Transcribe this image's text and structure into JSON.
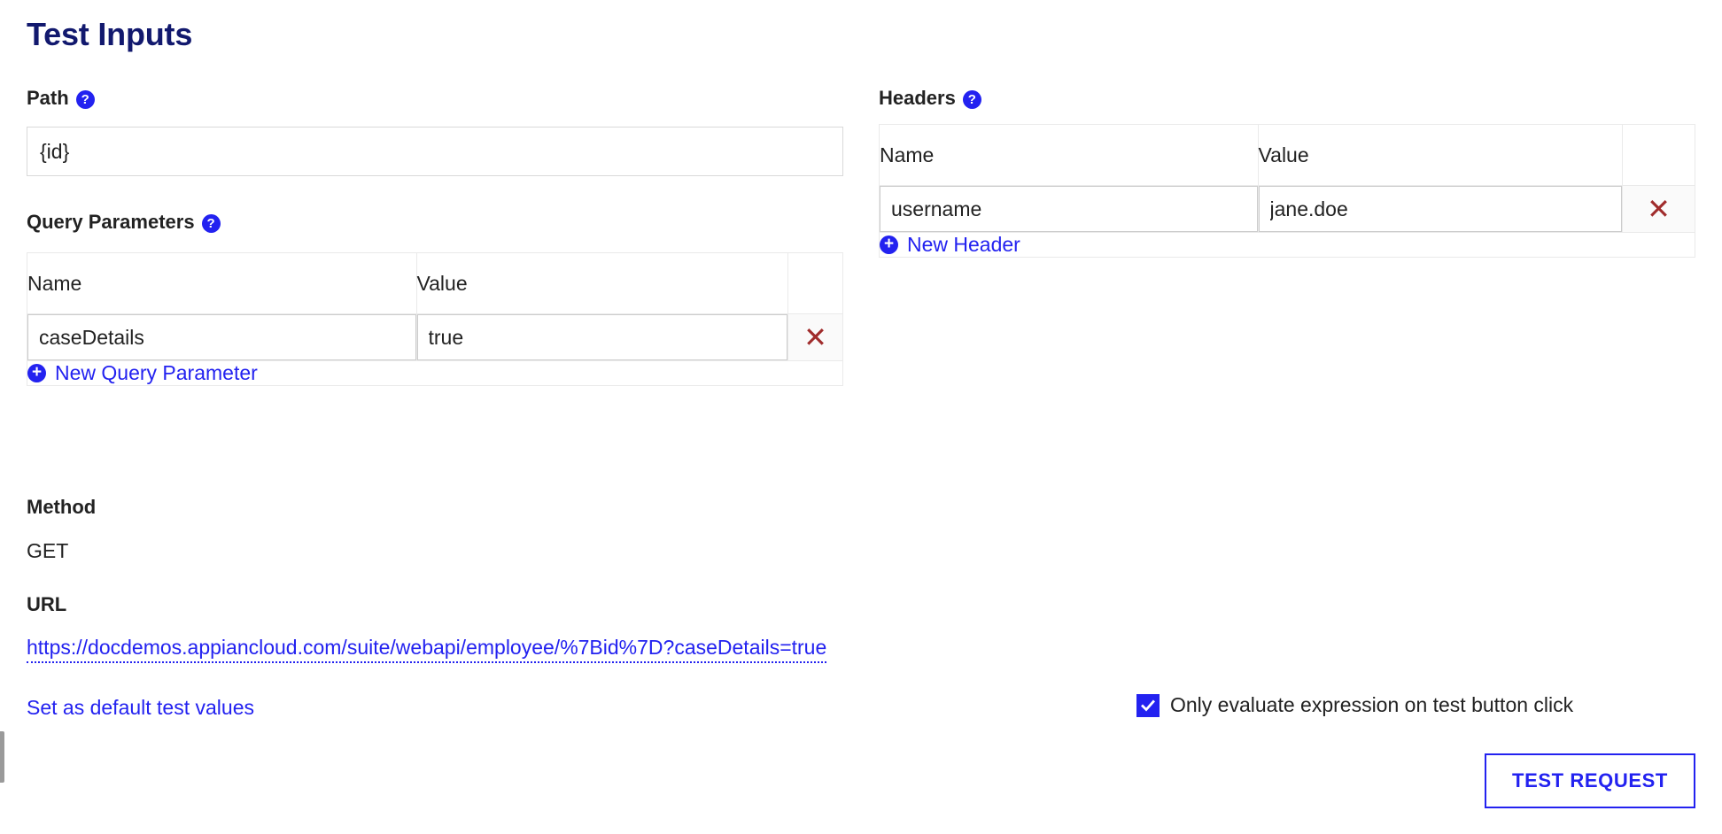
{
  "page": {
    "title": "Test Inputs"
  },
  "path": {
    "label": "Path",
    "help_icon": "help-circle-icon",
    "value": "{id}",
    "placeholder": ""
  },
  "query_parameters": {
    "label": "Query Parameters",
    "help_icon": "help-circle-icon",
    "columns": [
      "Name",
      "Value"
    ],
    "rows": [
      {
        "name": "caseDetails",
        "value": "true",
        "delete_label": "✕"
      }
    ],
    "add_row_label": "New Query Parameter",
    "add_row_icon": "plus-circle-icon"
  },
  "headers": {
    "label": "Headers",
    "help_icon": "help-circle-icon",
    "columns": [
      "Name",
      "Value"
    ],
    "rows": [
      {
        "name": "username",
        "value": "jane.doe",
        "delete_label": "✕"
      }
    ],
    "add_row_label": "New Header",
    "add_row_icon": "plus-circle-icon"
  },
  "method": {
    "label": "Method",
    "value": "GET"
  },
  "url": {
    "label": "URL",
    "value": "https://docdemos.appiancloud.com/suite/webapi/employee/%7Bid%7D?caseDetails=true"
  },
  "footer": {
    "set_default_link": "Set as default test values",
    "checkbox_label": "Only evaluate expression on test button click",
    "checkbox_checked": true,
    "test_button_label": "TEST REQUEST"
  },
  "colors": {
    "title": "#12196e",
    "link": "#2322f0",
    "accent": "#2322f0",
    "delete": "#a02c2c",
    "text": "#222222",
    "border": "#eaeaea",
    "row_bg": "#fafafa"
  }
}
